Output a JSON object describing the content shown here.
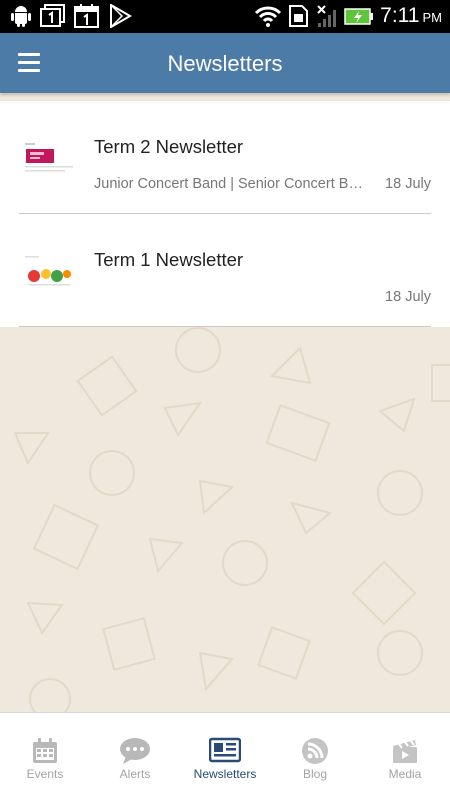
{
  "status_bar": {
    "time": "7:11",
    "ampm": "PM"
  },
  "header": {
    "title": "Newsletters",
    "color": "#4b7ba6"
  },
  "newsletters": [
    {
      "title": "Term 2 Newsletter",
      "subtitle": "Junior Concert Band | Senior Concert Band",
      "date": "18 July"
    },
    {
      "title": "Term 1 Newsletter",
      "subtitle": "",
      "date": "18 July"
    }
  ],
  "bottom_nav": {
    "tabs": [
      {
        "label": "Events",
        "icon": "calendar-icon",
        "active": false
      },
      {
        "label": "Alerts",
        "icon": "chat-bubble-icon",
        "active": false
      },
      {
        "label": "Newsletters",
        "icon": "newspaper-icon",
        "active": true
      },
      {
        "label": "Blog",
        "icon": "blog-icon",
        "active": false
      },
      {
        "label": "Media",
        "icon": "clapperboard-icon",
        "active": false
      }
    ]
  }
}
